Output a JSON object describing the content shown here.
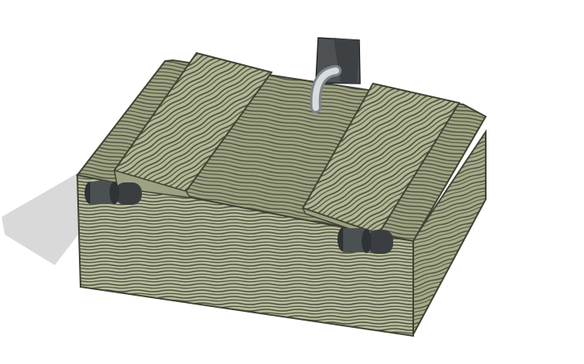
{
  "viewport": {
    "background": "#ffffff"
  },
  "model": {
    "description_name": "wooden-crate-model",
    "colors": {
      "wood_light": "#b8bc9c",
      "wood_mid": "#9fa483",
      "wood_dark": "#5f634d",
      "grain": "#4c503e",
      "shadow": "#d9d9d9",
      "hinge": "#4b5052",
      "hinge_dark": "#2f3335",
      "handle_block": "#4d5153",
      "pipe": "#c8ccd0"
    },
    "parts": [
      "left-lid-plank",
      "right-lid-plank",
      "center-top-panel",
      "front-panel",
      "right-side-panel",
      "left-hinge",
      "right-hinge",
      "back-latch-block",
      "curved-pipe"
    ]
  }
}
